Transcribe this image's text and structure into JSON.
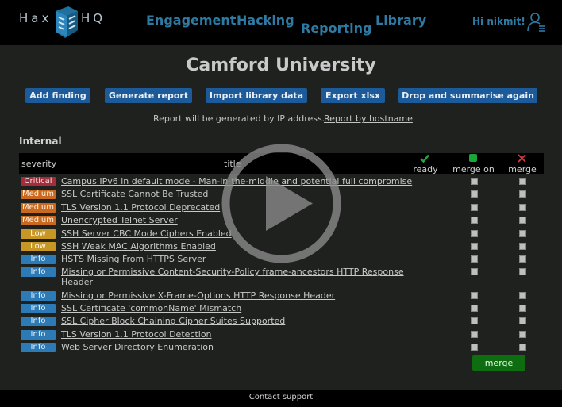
{
  "logo": {
    "left": "Hax",
    "right": "HQ"
  },
  "nav": [
    {
      "label": "Engagement"
    },
    {
      "label": "Hacking"
    },
    {
      "label": "Reporting"
    },
    {
      "label": "Library"
    }
  ],
  "user": {
    "greeting": "Hi nikmit!",
    "icon": "user-settings-icon"
  },
  "page": {
    "title": "Camford University"
  },
  "toolbar": {
    "add_finding": "Add finding",
    "generate_report": "Generate report",
    "import_library": "Import library data",
    "export_xlsx": "Export xlsx",
    "drop_summarise": "Drop and summarise again"
  },
  "note": {
    "text": "Report will be generated by IP address.",
    "link": "Report by hostname"
  },
  "section": {
    "title": "Internal"
  },
  "table": {
    "headers": {
      "severity": "severity",
      "title": "title",
      "ready": "ready",
      "merge_on": "merge on",
      "merge": "merge"
    },
    "rows": [
      {
        "severity": "Critical",
        "title": "Campus IPv6 in default mode - Man-in-the-middle and potential full compromise"
      },
      {
        "severity": "Medium",
        "title": "SSL Certificate Cannot Be Trusted"
      },
      {
        "severity": "Medium",
        "title": "TLS Version 1.1 Protocol Deprecated"
      },
      {
        "severity": "Medium",
        "title": "Unencrypted Telnet Server"
      },
      {
        "severity": "Low",
        "title": "SSH Server CBC Mode Ciphers Enabled"
      },
      {
        "severity": "Low",
        "title": "SSH Weak MAC Algorithms Enabled"
      },
      {
        "severity": "Info",
        "title": "HSTS Missing From HTTPS Server"
      },
      {
        "severity": "Info",
        "title": "Missing or Permissive Content-Security-Policy frame-ancestors HTTP Response Header"
      },
      {
        "severity": "Info",
        "title": "Missing or Permissive X-Frame-Options HTTP Response Header"
      },
      {
        "severity": "Info",
        "title": "SSL Certificate 'commonName' Mismatch"
      },
      {
        "severity": "Info",
        "title": "SSL Cipher Block Chaining Cipher Suites Supported"
      },
      {
        "severity": "Info",
        "title": "TLS Version 1.1 Protocol Detection"
      },
      {
        "severity": "Info",
        "title": "Web Server Directory Enumeration"
      }
    ],
    "merge_button": "merge"
  },
  "footer": {
    "contact": "Contact support"
  },
  "colors": {
    "critical": "#a22d3b",
    "medium": "#c9691f",
    "low": "#c79726",
    "info": "#2c7ab6",
    "accent": "#1c5a99",
    "nav": "#2e7aa3"
  }
}
